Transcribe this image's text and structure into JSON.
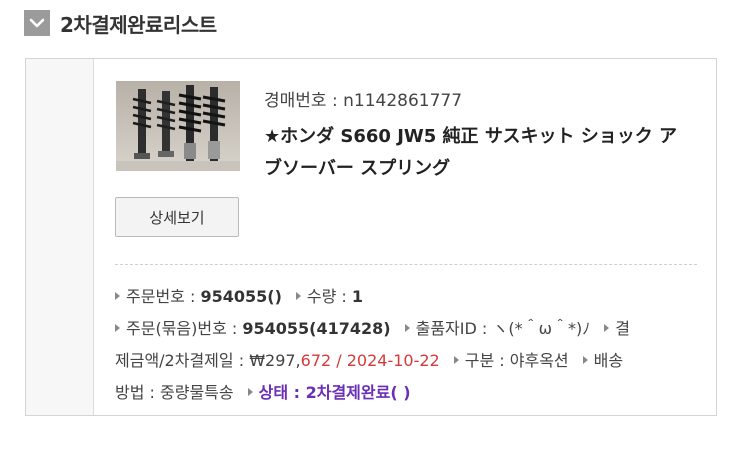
{
  "header": {
    "title": "2차결제완료리스트"
  },
  "item": {
    "auction_label": "경매번호 : ",
    "auction_no": "n1142861777",
    "title": "★ホンダ S660 JW5 純正 サスキット ショック アブソーバー スプリング",
    "detail_button": "상세보기"
  },
  "order": {
    "order_no_label": "주문번호 : ",
    "order_no": "954055()",
    "qty_label": "수량 : ",
    "qty": "1",
    "bundle_label": "주문(묶음)번호 : ",
    "bundle_no": "954055(417428)",
    "seller_label": "출품자ID : ",
    "seller_id": "ヽ(*＾ω＾*)ﾉ",
    "pay_label_a": "결",
    "pay_label_b": "제금액/2차결제일 : ",
    "pay_amount_prefix": "₩297,",
    "pay_amount_suffix": "672 / 2024-10-22",
    "category_label": "구분 : ",
    "category": "야후옥션",
    "ship_label_a": "배송",
    "ship_label_b": "방법 : ",
    "ship_method": "중량물특송",
    "status_label": "상태 : ",
    "status": "2차결제완료( )"
  },
  "colors": {
    "status": "#6a2fb5",
    "date": "#d43a3a",
    "header_box": "#9b9b9b"
  }
}
